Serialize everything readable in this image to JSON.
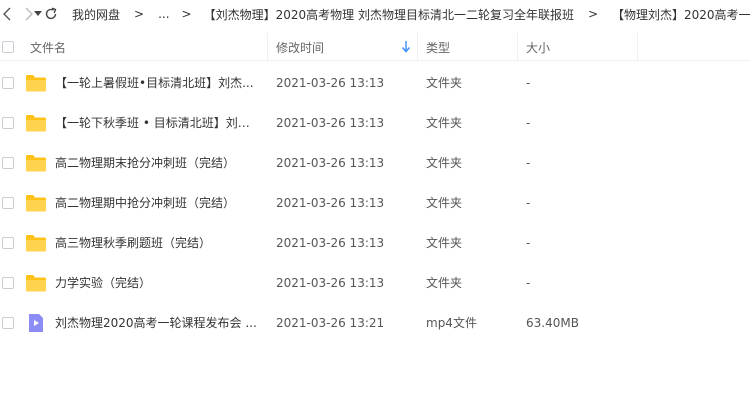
{
  "nav": {
    "back_icon": "chevron-left-icon",
    "forward_icon": "chevron-right-icon",
    "history_icon": "caret-down-icon",
    "refresh_icon": "refresh-icon"
  },
  "breadcrumb": {
    "items": [
      "我的网盘",
      "...",
      "【刘杰物理】2020高考物理 刘杰物理目标清北一二轮复习全年联报班",
      "【物理刘杰】2020高考一"
    ],
    "separator": ">"
  },
  "header": {
    "name": "文件名",
    "modified": "修改时间",
    "type": "类型",
    "size": "大小"
  },
  "colors": {
    "folder": "#ffd34d",
    "folder_tab": "#ffc21a",
    "video": "#8b8cf5",
    "sort_arrow": "#3b8cff"
  },
  "files": [
    {
      "name": "【一轮上暑假班•目标清北班】刘杰...",
      "time": "2021-03-26 13:13",
      "type": "文件夹",
      "size": "-",
      "icon": "folder-icon"
    },
    {
      "name": "【一轮下秋季班 • 目标清北班】刘杰...",
      "time": "2021-03-26 13:13",
      "type": "文件夹",
      "size": "-",
      "icon": "folder-icon"
    },
    {
      "name": "高二物理期末抢分冲刺班（完结）",
      "time": "2021-03-26 13:13",
      "type": "文件夹",
      "size": "-",
      "icon": "folder-icon"
    },
    {
      "name": "高二物理期中抢分冲刺班（完结）",
      "time": "2021-03-26 13:13",
      "type": "文件夹",
      "size": "-",
      "icon": "folder-icon"
    },
    {
      "name": "高三物理秋季刷题班（完结）",
      "time": "2021-03-26 13:13",
      "type": "文件夹",
      "size": "-",
      "icon": "folder-icon"
    },
    {
      "name": "力学实验（完结）",
      "time": "2021-03-26 13:13",
      "type": "文件夹",
      "size": "-",
      "icon": "folder-icon"
    },
    {
      "name": "刘杰物理2020高考一轮课程发布会 ...",
      "time": "2021-03-26 13:21",
      "type": "mp4文件",
      "size": "63.40MB",
      "icon": "video-file-icon"
    }
  ]
}
